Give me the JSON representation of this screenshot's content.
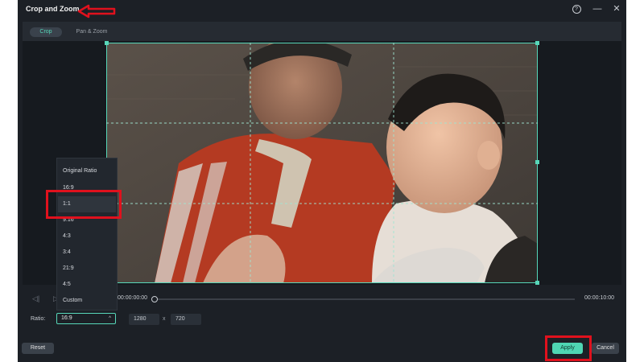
{
  "window": {
    "title": "Crop and Zoom",
    "help_icon": "help-circle-icon",
    "minimize_icon": "minimize-icon",
    "close_icon": "close-icon"
  },
  "tabs": [
    {
      "label": "Crop",
      "active": true
    },
    {
      "label": "Pan & Zoom",
      "active": false
    }
  ],
  "preview": {
    "image": "crop-preview-image"
  },
  "playback": {
    "current_time": "00:00:00:00",
    "end_time": "00:00:10:00",
    "progress": 0.0
  },
  "ratio": {
    "label": "Ratio:",
    "selected": "16:9",
    "width": "1280",
    "separator": "x",
    "height": "720",
    "options": [
      "Original Ratio",
      "16:9",
      "1:1",
      "9:16",
      "4:3",
      "3:4",
      "21:9",
      "4:5",
      "Custom"
    ],
    "highlighted": "1:1"
  },
  "buttons": {
    "reset": "Reset",
    "apply": "Apply",
    "cancel": "Cancel"
  },
  "colors": {
    "accent": "#57d7b9",
    "annotation": "#e0111d",
    "background": "#1c2026"
  }
}
